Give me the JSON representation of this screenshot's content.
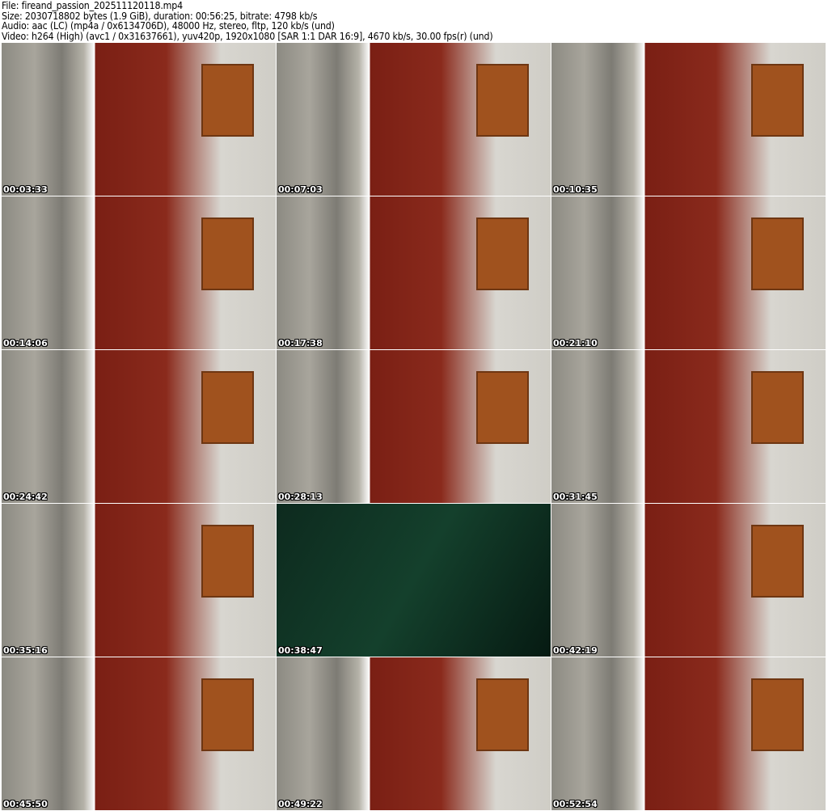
{
  "header": {
    "file": "File: fireand_passion_202511120118.mp4",
    "size": "Size: 2030718802 bytes (1.9 GiB), duration: 00:56:25, bitrate: 4798 kb/s",
    "audio": "Audio: aac (LC) (mp4a / 0x6134706D), 48000 Hz, stereo, fltp, 120 kb/s (und)",
    "video": "Video: h264 (High) (avc1 / 0x31637661), yuv420p, 1920x1080 [SAR 1:1 DAR 16:9], 4670 kb/s, 30.00 fps(r) (und)"
  },
  "thumbnails": [
    {
      "timestamp": "00:03:33"
    },
    {
      "timestamp": "00:07:03"
    },
    {
      "timestamp": "00:10:35"
    },
    {
      "timestamp": "00:14:06"
    },
    {
      "timestamp": "00:17:38"
    },
    {
      "timestamp": "00:21:10"
    },
    {
      "timestamp": "00:24:42"
    },
    {
      "timestamp": "00:28:13"
    },
    {
      "timestamp": "00:31:45"
    },
    {
      "timestamp": "00:35:16"
    },
    {
      "timestamp": "00:38:47",
      "dark": true
    },
    {
      "timestamp": "00:42:19"
    },
    {
      "timestamp": "00:45:50"
    },
    {
      "timestamp": "00:49:22"
    },
    {
      "timestamp": "00:52:54"
    }
  ]
}
